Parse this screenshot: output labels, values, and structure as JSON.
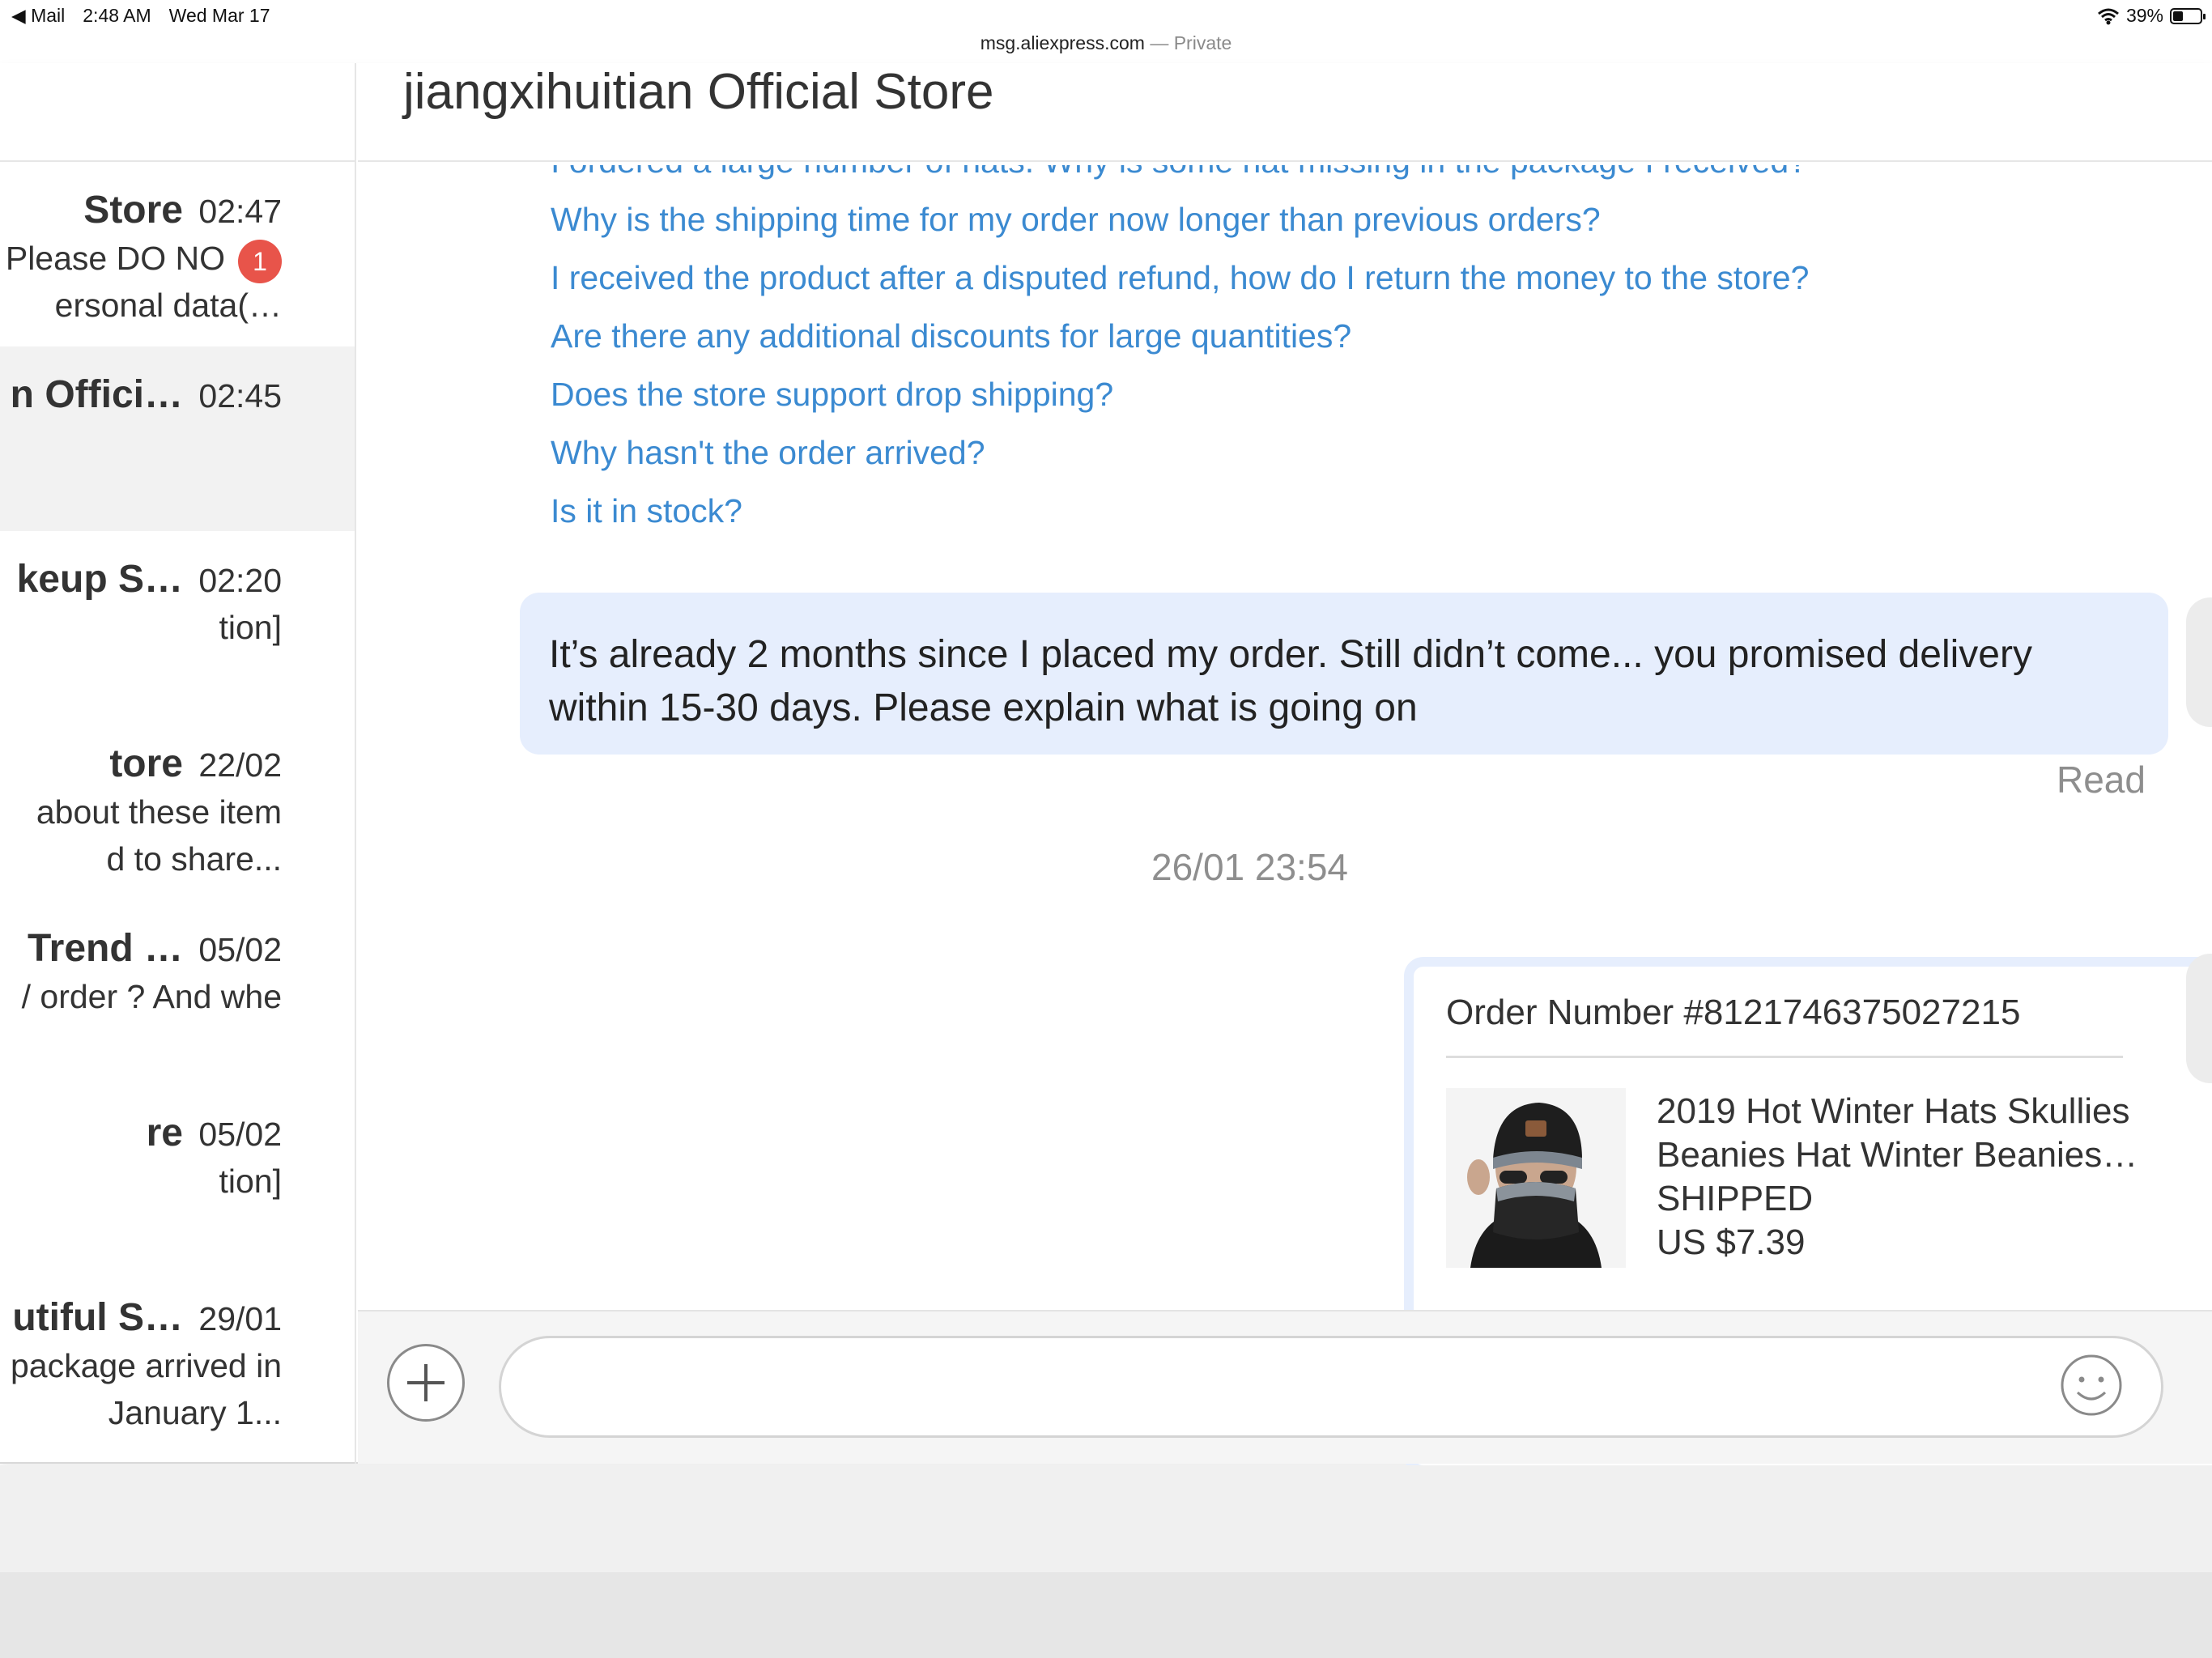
{
  "status_bar": {
    "back_app": "Mail",
    "time": "2:48 AM",
    "date": "Wed Mar 17",
    "battery": "39%"
  },
  "browser": {
    "url": "msg.aliexpress.com",
    "mode": "— Private"
  },
  "sidebar": {
    "conversations": [
      {
        "name": "Store",
        "time": "02:47",
        "preview_line1": "Please DO NO",
        "preview_line2": "ersonal data(…",
        "unread": "1"
      },
      {
        "name": "n Offici…",
        "time": "02:45",
        "preview_line1": "",
        "preview_line2": "",
        "active": true
      },
      {
        "name": "keup S…",
        "time": "02:20",
        "preview_line1": "tion]",
        "preview_line2": ""
      },
      {
        "name": "tore",
        "time": "22/02",
        "preview_line1": " about these item",
        "preview_line2": "d to share..."
      },
      {
        "name": "Trend …",
        "time": "05/02",
        "preview_line1": "/ order ? And whe",
        "preview_line2": ""
      },
      {
        "name": "re",
        "time": "05/02",
        "preview_line1": "tion]",
        "preview_line2": ""
      },
      {
        "name": "utiful S…",
        "time": "29/01",
        "preview_line1": "package arrived in",
        "preview_line2": "January 1..."
      }
    ]
  },
  "chat": {
    "store_title": "jiangxihuitian Official Store",
    "faq": [
      "I ordered a large number of hats. Why is some hat missing in the package I received?",
      "Why is the shipping time for my order now longer than previous orders?",
      "I received the product after a disputed refund, how do I return the money to the store?",
      "Are there any additional discounts for large quantities?",
      "Does the store support drop shipping?",
      "Why hasn't the order arrived?",
      "Is it in stock?"
    ],
    "message": {
      "line1": "It’s already 2 months since I placed my order. Still didn’t come... you promised delivery",
      "line2": "within 15-30 days. Please explain what is going on",
      "status": "Read"
    },
    "timestamp": "26/01 23:54",
    "order": {
      "number": "Order Number #8121746375027215",
      "title_line1": "2019 Hot Winter Hats Skullies",
      "title_line2": "Beanies Hat Winter Beanies…",
      "status": "SHIPPED",
      "price": "US $7.39"
    }
  },
  "composer": {
    "placeholder": ""
  },
  "colors": {
    "link": "#3b8ad1",
    "bubble": "#e6eefd",
    "badge": "#e8544a"
  }
}
